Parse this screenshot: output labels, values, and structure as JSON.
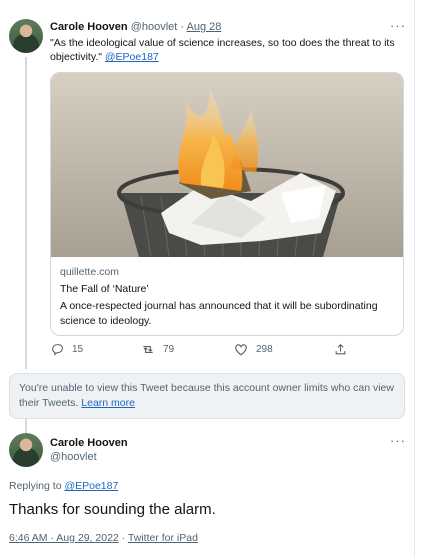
{
  "tweet1": {
    "author_name": "Carole Hooven",
    "handle": "@hoovlet",
    "separator": "·",
    "date": "Aug 28",
    "text_before": "\"As the ideological value of science increases, so too does the threat to its objectivity.\" ",
    "mention": "@EPoe187",
    "more_icon": "···",
    "card": {
      "domain": "quillette.com",
      "title": "The Fall of ‘Nature’",
      "description": "A once-respected journal has announced that it will be subordinating science to ideology."
    },
    "actions": {
      "replies": "15",
      "retweets": "79",
      "likes": "298"
    }
  },
  "notice": {
    "text": "You're unable to view this Tweet because this account owner limits who can view their Tweets. ",
    "link": "Learn more"
  },
  "tweet2": {
    "author_name": "Carole Hooven",
    "handle": "@hoovlet",
    "more_icon": "···",
    "replying_to_label": "Replying to ",
    "replying_to": "@EPoe187",
    "text": "Thanks for sounding the alarm.",
    "timestamp": "6:46 AM · Aug 29, 2022",
    "separator": "·",
    "source": "Twitter for iPad"
  },
  "colors": {
    "link": "#1d66c2",
    "muted": "#536471",
    "border": "#cfd9de",
    "notice_bg": "#eef2f5"
  },
  "icons": [
    "reply-icon",
    "retweet-icon",
    "like-icon",
    "share-icon",
    "more-icon"
  ]
}
